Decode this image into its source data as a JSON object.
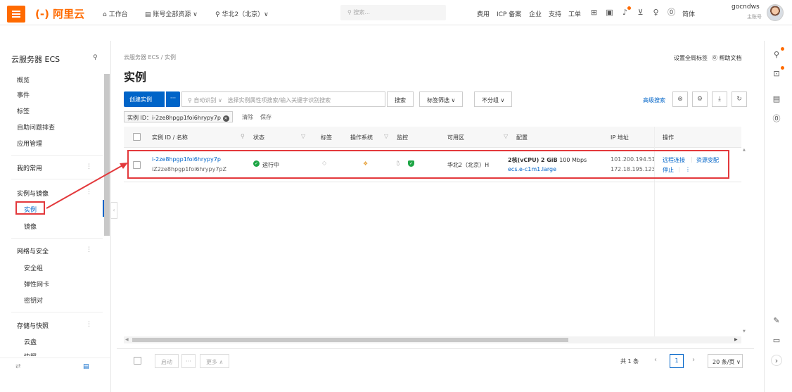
{
  "topbar": {
    "logo": "(-) 阿里云",
    "workbench": "工作台",
    "account_resources": "账号全部资源 ∨",
    "region": "华北2（北京）∨",
    "search_placeholder": "搜索...",
    "links": [
      "费用",
      "ICP 备案",
      "企业",
      "支持",
      "工单"
    ],
    "lang": "简体",
    "username": "gocndws",
    "account_type": "主账号"
  },
  "sidebar": {
    "title": "云服务器 ECS",
    "items": [
      "概览",
      "事件",
      "标签",
      "自助问题排查",
      "应用管理"
    ],
    "favorites": "我的常用",
    "group_instances": "实例与镜像",
    "sub_instances": [
      "实例",
      "镜像"
    ],
    "group_network": "网络与安全",
    "sub_network": [
      "安全组",
      "弹性网卡",
      "密钥对"
    ],
    "group_storage": "存储与快照",
    "sub_storage": [
      "云盘",
      "快照"
    ],
    "more": "⋮"
  },
  "main": {
    "breadcrumb": "云服务器 ECS / 实例",
    "title": "实例",
    "top_links": [
      "设置全局标签",
      "帮助文档"
    ],
    "create_button": "创建实例",
    "more_button": "···",
    "filter_type": "自动识别 ∨",
    "filter_placeholder": "选择实例属性项搜索/输入关键字识别搜索",
    "search_button": "搜索",
    "tag_filter": "标签筛选 ∨",
    "group_filter": "不分组 ∨",
    "advanced_search": "高级搜索",
    "active_tag": "实例 ID：i-2ze8hpgp1foi6hrypy7p",
    "clear": "清除",
    "save": "保存"
  },
  "table": {
    "columns": [
      "实例 ID / 名称",
      "状态",
      "标签",
      "操作系统",
      "监控",
      "可用区",
      "配置",
      "IP 地址",
      "操作"
    ],
    "rows": [
      {
        "id": "i-2ze8hpgp1foi6hrypy7p",
        "name": "iZ2ze8hpgp1foi6hrypy7pZ",
        "status": "运行中",
        "zone": "华北2（北京）H",
        "config_cpu": "2核(vCPU)",
        "config_mem": "2 GiB",
        "config_bw": "100 Mbps",
        "instance_type": "ecs.e-c1m1.large",
        "public_ip": "101.200.194.51",
        "private_ip": "172.18.195.123",
        "actions": [
          "远程连接",
          "资源变配",
          "停止",
          "⋮"
        ]
      }
    ]
  },
  "footer": {
    "start": "启动",
    "more_dots": "···",
    "more": "更多 ∧",
    "total": "共 1 条",
    "page": "1",
    "page_size": "20 条/页 ∨"
  },
  "colors": {
    "brand": "#ff6a00",
    "primary": "#0064c8",
    "highlight": "#e3393c",
    "running": "#1fa646"
  }
}
